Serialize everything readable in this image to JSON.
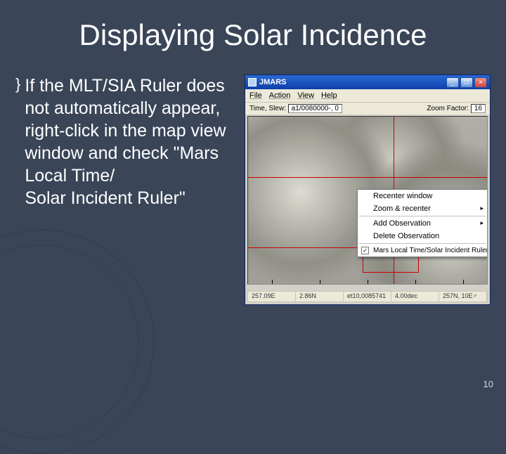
{
  "slide": {
    "title": "Displaying Solar Incidence",
    "bullet_symbol": "}",
    "bullet_text": "If the MLT/SIA Ruler does not automatically appear, right-click in the map view window and check \"Mars Local Time/\nSolar Incident Ruler\"",
    "number": "10"
  },
  "window": {
    "app_title": "JMARS",
    "minimize": "_",
    "maximize": "□",
    "close": "×",
    "menu": {
      "file": "File",
      "action": "Action",
      "view": "View",
      "help": "Help"
    },
    "toolbar": {
      "time_label": "Time, Slew:",
      "time_value": "a1/0080000-, 0",
      "zoom_label": "Zoom Factor:",
      "zoom_value": "16"
    },
    "context_menu": {
      "recenter": "Recenter window",
      "zoom_recenter": "Zoom & recenter",
      "add_obs": "Add Observation",
      "del_obs": "Delete Observation",
      "mlt_ruler": "Mars Local Time/Solar Incident Ruler",
      "check": "✓"
    },
    "status": {
      "c0": "257.09E",
      "c1": "2.86N",
      "c2": "et10,0085741",
      "c3": "4.00dec",
      "c4": "257N, 10E♂"
    }
  }
}
